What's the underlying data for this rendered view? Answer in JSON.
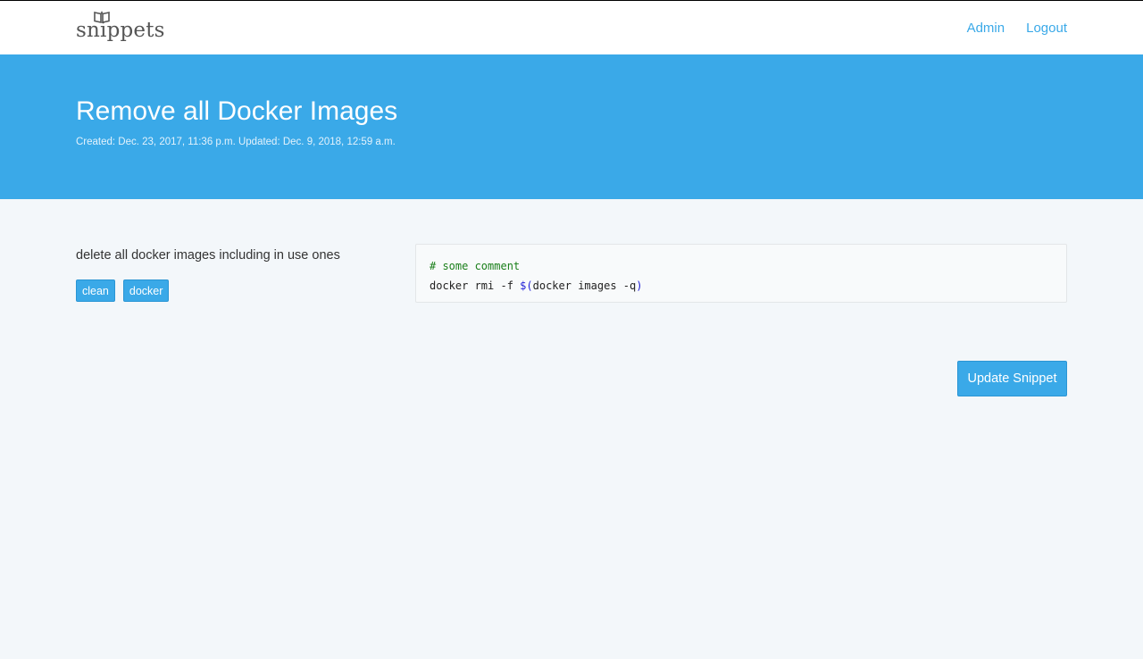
{
  "navbar": {
    "brand": "snippets",
    "brand_icon": "open-book-icon",
    "links": [
      "Admin",
      "Logout"
    ]
  },
  "hero": {
    "title": "Remove all Docker Images",
    "meta": "Created: Dec. 23, 2017, 11:36 p.m. Updated: Dec. 9, 2018, 12:59 a.m."
  },
  "snippet": {
    "description": "delete all docker images including in use ones",
    "tags": [
      "clean",
      "docker"
    ],
    "code": {
      "comment": "# some comment",
      "cmd": "docker rmi -f ",
      "dollar": "$",
      "open_paren": "(",
      "inner": "docker images -q",
      "close_paren": ")"
    }
  },
  "actions": {
    "update_label": "Update Snippet"
  },
  "colors": {
    "accent": "#3aa9e8",
    "background": "#f3f7fa",
    "code_comment": "#1a7f1a",
    "code_keyword": "#1d1dd6"
  }
}
